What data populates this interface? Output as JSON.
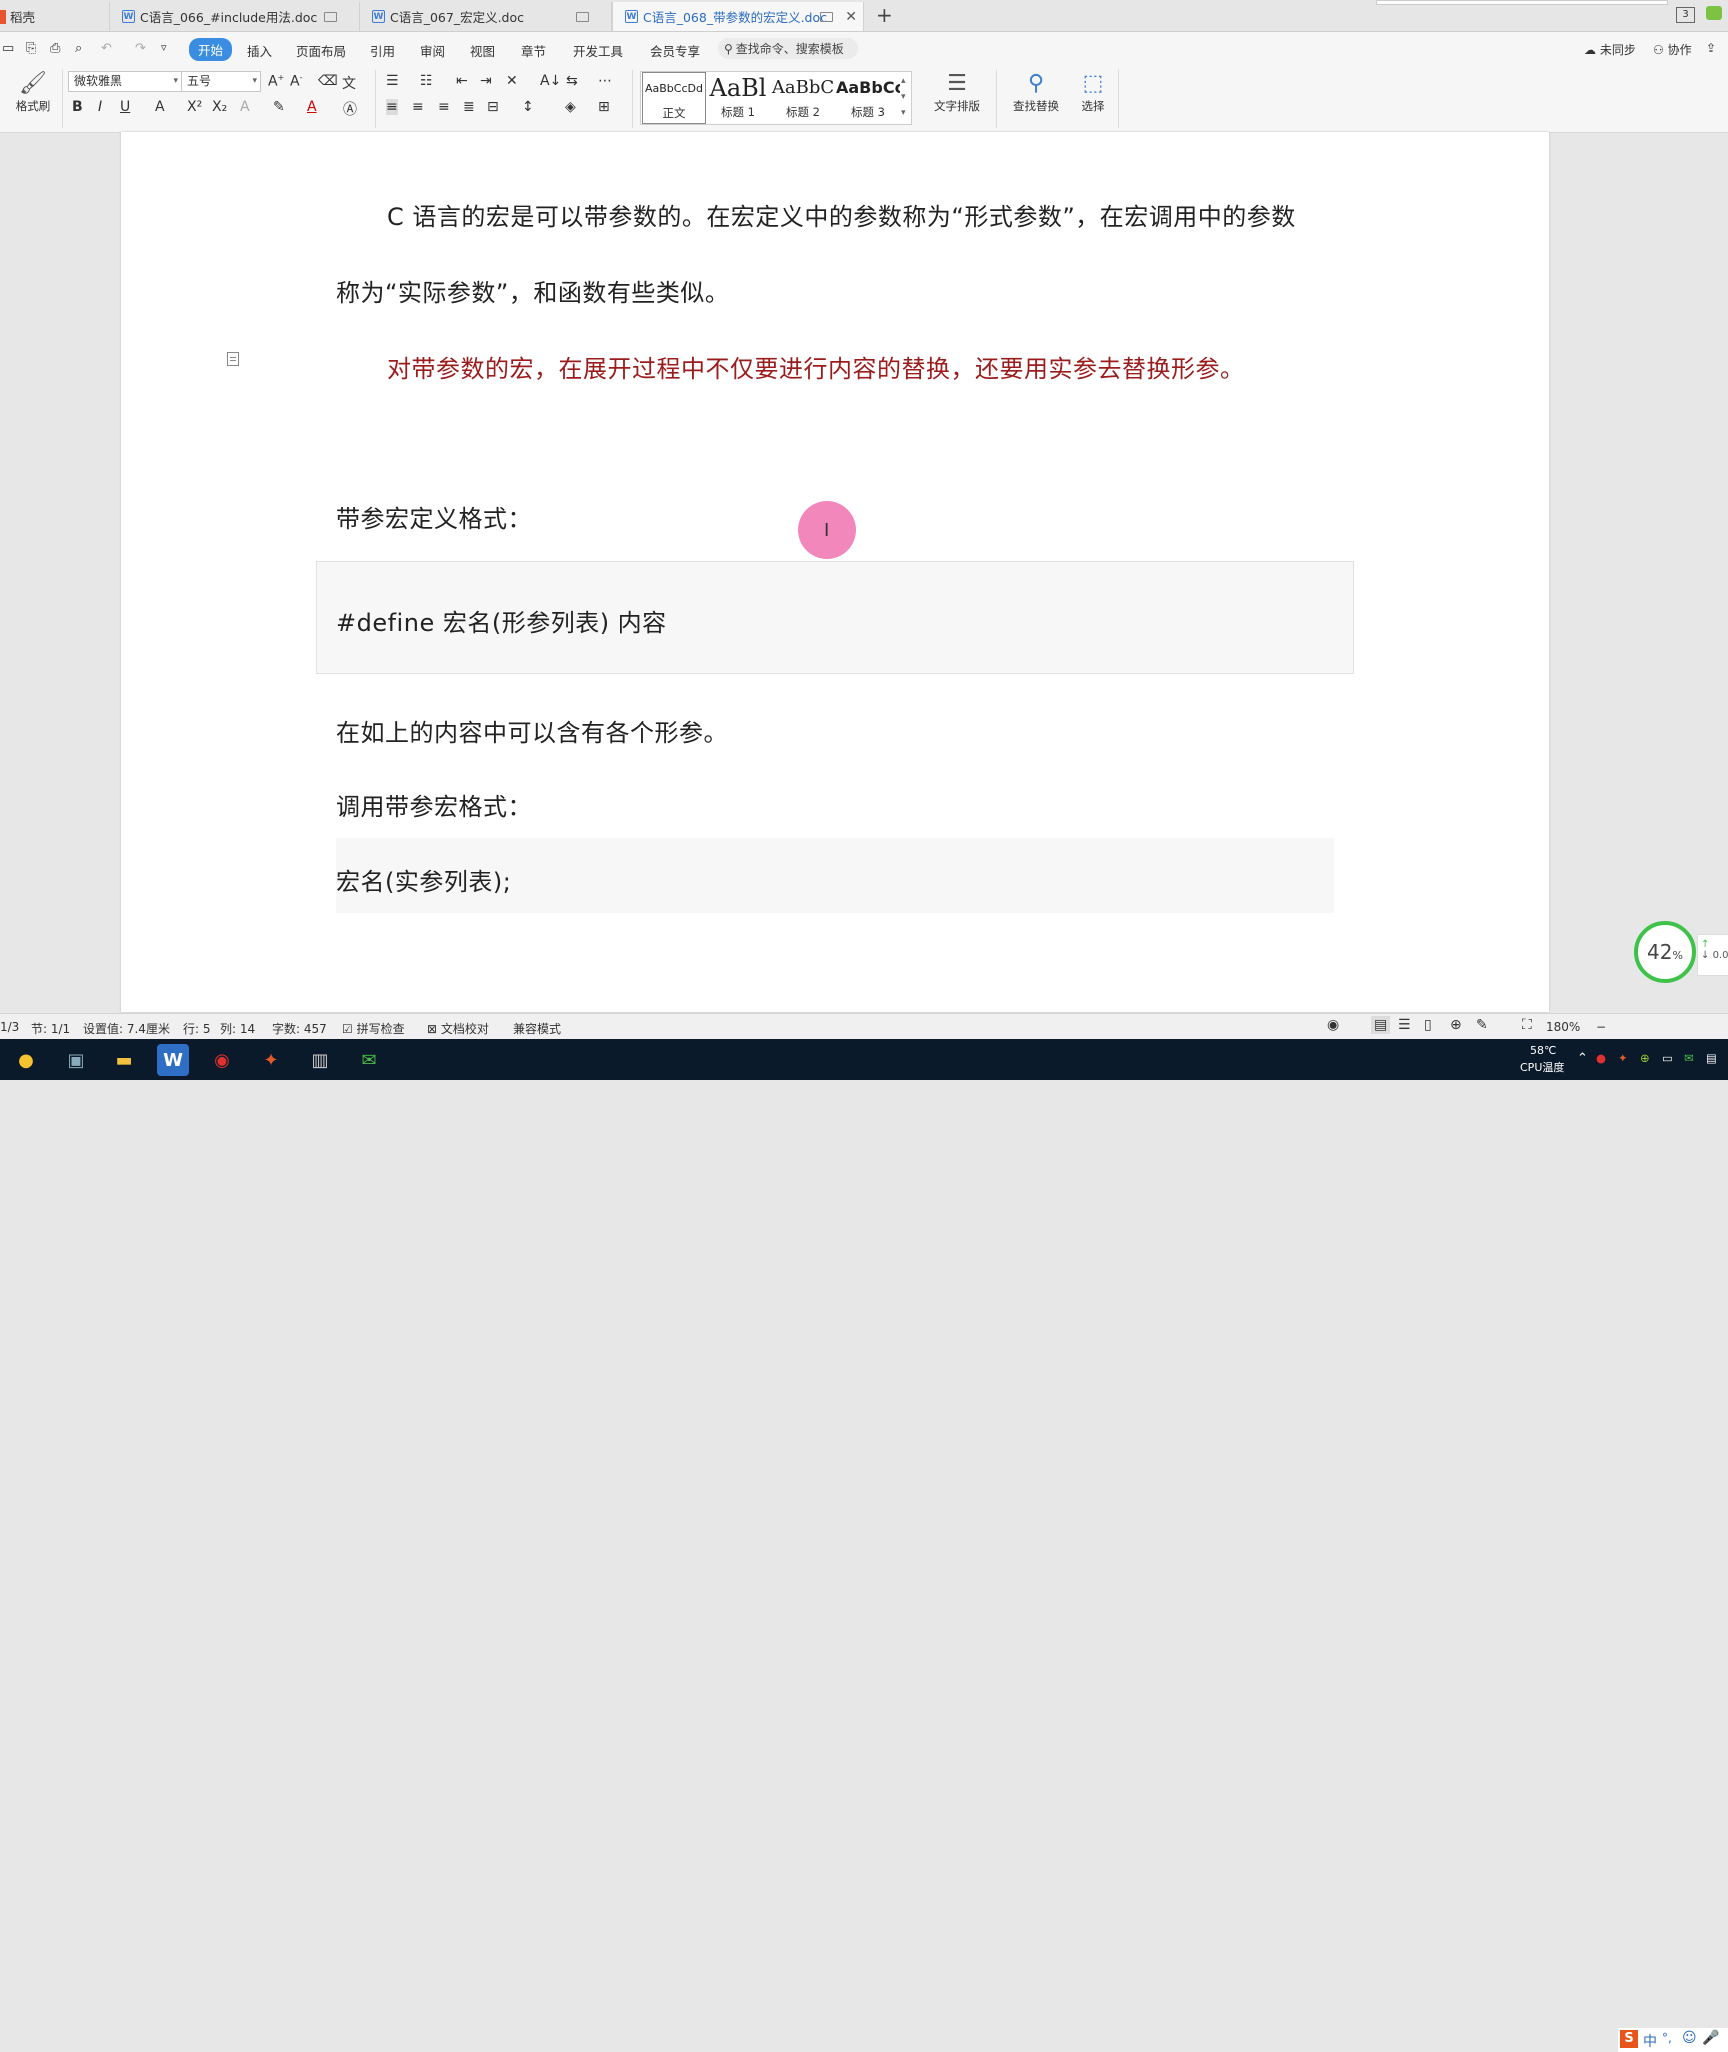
{
  "tabs": [
    {
      "label": "稻壳"
    },
    {
      "label": "C语言_066_#include用法.doc"
    },
    {
      "label": "C语言_067_宏定义.doc"
    },
    {
      "label": "C语言_068_带参数的宏定义.doc"
    }
  ],
  "tabbar": {
    "right_badge": "3"
  },
  "menu": {
    "items": [
      "开始",
      "插入",
      "页面布局",
      "引用",
      "审阅",
      "视图",
      "章节",
      "开发工具",
      "会员专享"
    ],
    "search_placeholder": "查找命令、搜索模板",
    "sync": "未同步",
    "collab": "协作"
  },
  "ribbon": {
    "format_painter": "格式刷",
    "font_name": "微软雅黑",
    "font_size": "五号",
    "styles": [
      {
        "preview": "AaBbCcDd",
        "name": "正文"
      },
      {
        "preview": "AaBl",
        "name": "标题 1"
      },
      {
        "preview": "AaBbC",
        "name": "标题 2"
      },
      {
        "preview": "AaBbCc",
        "name": "标题 3"
      }
    ],
    "text_layout": "文字排版",
    "find_replace": "查找替换",
    "select": "选择"
  },
  "document": {
    "para1_line1": "C 语言的宏是可以带参数的。在宏定义中的参数称为“形式参数”，在宏调用中的参数",
    "para1_line2": "称为“实际参数”，和函数有些类似。",
    "para2": "对带参数的宏，在展开过程中不仅要进行内容的替换，还要用实参去替换形参。",
    "heading1": "带参宏定义格式：",
    "code1": "#define  宏名(形参列表)  内容",
    "para3": "在如上的内容中可以含有各个形参。",
    "heading2": "调用带参宏格式：",
    "code2": "宏名(实参列表);"
  },
  "widget": {
    "percent": "42",
    "percent_sign": "%",
    "net": "0.0"
  },
  "status": {
    "page": "1/3",
    "section": "节: 1/1",
    "setting": "设置值: 7.4厘米",
    "row": "行: 5",
    "col": "列: 14",
    "words": "字数: 457",
    "spell": "拼写检查",
    "proof": "文档校对",
    "compat": "兼容模式",
    "zoom": "180%"
  },
  "taskbar": {
    "temp": "58℃",
    "temp_label": "CPU温度",
    "ime": "中"
  },
  "colors": {
    "accent": "#3a8de0",
    "red_text": "#9b1c1c",
    "ring": "#3ec24a"
  }
}
